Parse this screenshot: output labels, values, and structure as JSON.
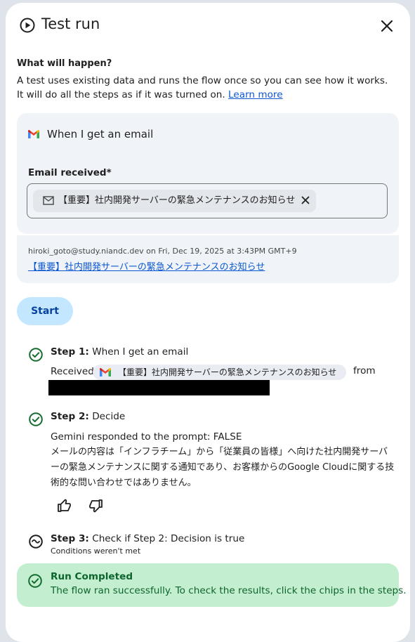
{
  "header": {
    "title": "Test run",
    "icons": {
      "play": "play-circle-icon",
      "close": "close-icon"
    }
  },
  "intro": {
    "heading": "What will happen?",
    "description": "A test uses existing data and runs the flow once so you can see how it works. It will do all the steps as if it was turned on.",
    "learn_more": "Learn more"
  },
  "trigger": {
    "label": "When I get an email",
    "icon": "gmail-icon",
    "email_field_label": "Email received*",
    "email_chip": "【重要】社内開発サーバーの緊急メンテナンスのお知らせ"
  },
  "meta": {
    "sender_line": "hiroki_goto@study.niandc.dev on Fri, Dec 19, 2025 at 3:43PM GMT+9",
    "subject_link": "【重要】社内開発サーバーの緊急メンテナンスのお知らせ"
  },
  "start_button": "Start",
  "steps": [
    {
      "label": "Step 1:",
      "name": "When I get an email",
      "status": "success",
      "received_prefix": "Received",
      "received_chip": "【重要】社内開発サーバーの緊急メンテナンスのお知らせ",
      "from_text": "from"
    },
    {
      "label": "Step 2:",
      "name": "Decide",
      "status": "success",
      "response_line": "Gemini responded to the prompt: FALSE",
      "response_body": "メールの内容は「インフラチーム」から「従業員の皆様」へ向けた社内開発サーバーの緊急メンテナンスに関する通知であり、お客様からのGoogle Cloudに関する技術的な問い合わせではありません。"
    },
    {
      "label": "Step 3:",
      "name": "Check if Step 2: Decision is true",
      "status": "skipped",
      "note": "Conditions weren't met"
    }
  ],
  "completed": {
    "title": "Run Completed",
    "description": "The flow ran successfully. To check the results, click the chips in the steps."
  },
  "colors": {
    "accent": "#0b57d0",
    "success": "#146c2e",
    "completed_bg": "#c4eed0",
    "start_bg": "#c2e7ff",
    "card_bg": "#f0f4f9"
  }
}
